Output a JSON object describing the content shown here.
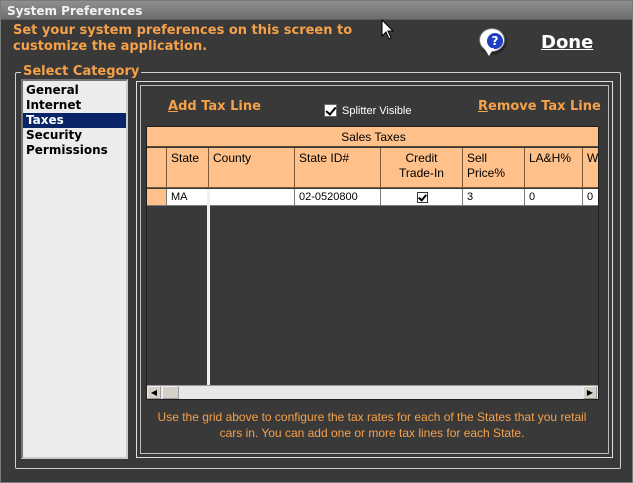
{
  "window": {
    "title": "System Preferences"
  },
  "intro_text": "Set your system preferences on this screen to customize the application.",
  "help": {
    "icon": "help-question-icon",
    "label": "?"
  },
  "done_label": "Done",
  "category": {
    "legend": "Select Category",
    "items": [
      {
        "label": "General",
        "selected": false
      },
      {
        "label": "Internet",
        "selected": false
      },
      {
        "label": "Taxes",
        "selected": true
      },
      {
        "label": "Security",
        "selected": false
      },
      {
        "label": "Permissions",
        "selected": false
      }
    ]
  },
  "taxes": {
    "add_first": "A",
    "add_rest": "dd Tax Line",
    "remove_first": "R",
    "remove_rest": "emove Tax Line",
    "splitter_label": "Splitter Visible",
    "splitter_checked": true,
    "grid": {
      "title": "Sales Taxes",
      "columns": [
        "State",
        "County",
        "State ID#",
        "Credit Trade-In",
        "Sell Price%",
        "LA&H%",
        "W"
      ],
      "col_state": "State",
      "col_county": "County",
      "col_stateid": "State ID#",
      "col_credit_1": "Credit",
      "col_credit_2": "Trade-In",
      "col_sell_1": "Sell",
      "col_sell_2": "Price%",
      "col_lah": "LA&H%",
      "col_w": "W",
      "rows": [
        {
          "state": "MA",
          "county": "",
          "state_id": "02-0520800",
          "credit_trade_in": true,
          "sell_price": "3",
          "lah": "0",
          "w": "0"
        }
      ]
    },
    "hint": "Use the grid above to configure the tax rates for each of the States that you retail cars in.  You can add one or more tax lines for each State."
  },
  "colors": {
    "background": "#3a3939",
    "accent": "#f5a14a",
    "grid_header": "#ffc08a",
    "selection": "#0a246a"
  }
}
